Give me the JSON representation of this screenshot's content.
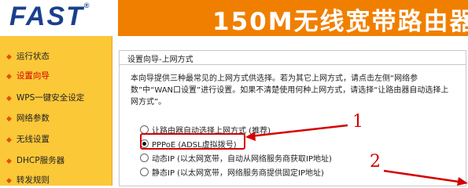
{
  "header": {
    "logo": "FAST",
    "trademark": "®",
    "title": "150M无线宽带路由器"
  },
  "sidebar": {
    "items": [
      {
        "label": "运行状态",
        "active": false
      },
      {
        "label": "设置向导",
        "active": true
      },
      {
        "label": "WPS一键安全设定",
        "active": false
      },
      {
        "label": "网络参数",
        "active": false
      },
      {
        "label": "无线设置",
        "active": false
      },
      {
        "label": "DHCP服务器",
        "active": false
      },
      {
        "label": "转发规则",
        "active": false
      }
    ]
  },
  "panel": {
    "title": "设置向导-上网方式",
    "description": "本向导提供三种最常见的上网方式供选择。若为其它上网方式，请点击左侧“网络参数”中“WAN口设置”进行设置。如果不清楚使用何种上网方式，请选择“让路由器自动选择上网方式”。",
    "options": [
      {
        "label": "让路由器自动选择上网方式 (推荐)",
        "checked": false
      },
      {
        "label": "PPPoE (ADSL虚拟拨号)",
        "checked": true
      },
      {
        "label": "动态IP (以太网宽带，自动从网络服务商获取IP地址)",
        "checked": false
      },
      {
        "label": "静态IP (以太网宽带，网络服务商提供固定IP地址)",
        "checked": false
      }
    ]
  },
  "annotations": {
    "marker1": "1",
    "marker2": "2"
  },
  "colors": {
    "orange": "#f07f00",
    "sidebar": "#fbc838",
    "red": "#d40000",
    "logo": "#1a3f8c"
  }
}
